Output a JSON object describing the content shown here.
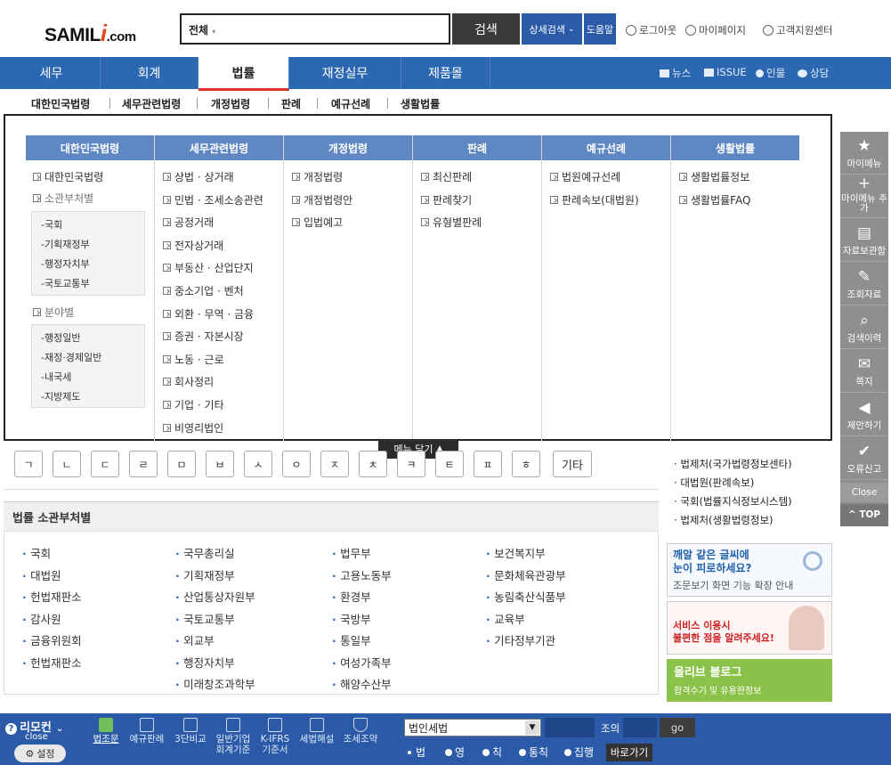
{
  "header": {
    "logo": {
      "left": "SAMIL",
      "i": "i",
      "right": ".com"
    },
    "search_scope": "전체",
    "search_button": "검색",
    "advanced_search": "상세검색",
    "help": "도움말",
    "logout": "로그아웃",
    "mypage": "마이페이지",
    "support": "고객지원센터"
  },
  "nav": {
    "items": [
      "세무",
      "회계",
      "법률",
      "재정실무",
      "제품몰"
    ],
    "active": "법률",
    "utils": [
      "뉴스",
      "ISSUE",
      "인물",
      "상담"
    ]
  },
  "subnav": [
    "대한민국법령",
    "세무관련법령",
    "개정법령",
    "판례",
    "예규선례",
    "생활법률"
  ],
  "panel": {
    "columns": [
      {
        "head": "대한민국법령",
        "links": [
          "대한민국법령"
        ],
        "group1": "소관부처별",
        "group1_items": [
          "국회",
          "기획재정부",
          "행정자치부",
          "국토교통부"
        ],
        "group2": "분야별",
        "group2_items": [
          "행정일반",
          "재정·경제일반",
          "내국세",
          "지방제도"
        ]
      },
      {
        "head": "세무관련법령",
        "links": [
          "상법 · 상거래",
          "민법 · 조세소송관련",
          "공정거래",
          "전자상거래",
          "부동산 · 산업단지",
          "중소기업 · 벤처",
          "외환 · 무역 · 금융",
          "증권 · 자본시장",
          "노동 · 근로",
          "회사정리",
          "기업 · 기타",
          "비영리법인"
        ]
      },
      {
        "head": "개정법령",
        "links": [
          "개정법령",
          "개정법령안",
          "입법예고"
        ]
      },
      {
        "head": "판례",
        "links": [
          "최신판례",
          "판례찾기",
          "유형별판례"
        ]
      },
      {
        "head": "예규선례",
        "links": [
          "법원예규선례",
          "판례속보(대법원)"
        ]
      },
      {
        "head": "생활법률",
        "links": [
          "생활법률정보",
          "생활법률FAQ"
        ]
      }
    ],
    "close_label": "메뉴 닫기"
  },
  "consonants": [
    "ㄱ",
    "ㄴ",
    "ㄷ",
    "ㄹ",
    "ㅁ",
    "ㅂ",
    "ㅅ",
    "ㅇ",
    "ㅈ",
    "ㅊ",
    "ㅋ",
    "ㅌ",
    "ㅍ",
    "ㅎ",
    "기타"
  ],
  "related_links": [
    "법제처(국가법령정보센타)",
    "대법원(판례속보)",
    "국회(법률지식정보시스템)",
    "법제처(생활법령정보)"
  ],
  "ministries": {
    "title": "법률 소관부처별",
    "col1": [
      "국회",
      "대법원",
      "헌법재판소",
      "감사원",
      "금융위원회",
      "헌법재판소"
    ],
    "col2": [
      "국무총리실",
      "기획재정부",
      "산업통상자원부",
      "국토교통부",
      "외교부",
      "행정자치부",
      "미래창조과학부"
    ],
    "col3": [
      "법무부",
      "고용노동부",
      "환경부",
      "국방부",
      "통일부",
      "여성가족부",
      "해양수산부"
    ],
    "col4": [
      "보건복지부",
      "문화체육관광부",
      "농림축산식품부",
      "교육부",
      "기타정부기관"
    ]
  },
  "ads": {
    "ad1_title1": "깨알 같은 글씨에",
    "ad1_title2": "눈이 피로하세요?",
    "ad1_sub": "조문보기 화면 기능 확장 안내",
    "ad2_line1": "서비스 이용시",
    "ad2_line2": "불편한 점을 알려주세요!",
    "ad3_title": "올리브 블로그",
    "ad3_sub": "합격수기 및 유용한정보"
  },
  "dock": {
    "items": [
      "마이메뉴",
      "마이메뉴 추가",
      "자료보관함",
      "조회자료",
      "검색이력",
      "쪽지",
      "제안하기",
      "오류신고"
    ],
    "icons": [
      "star-icon",
      "plus-icon",
      "document-icon",
      "edit-icon",
      "search-icon",
      "message-icon",
      "megaphone-icon",
      "check-icon"
    ],
    "close": "Close",
    "top": "TOP"
  },
  "bottom": {
    "remote": "리모컨",
    "remote_close": "close",
    "settings": "설정",
    "tools": [
      "법조문",
      "예규판례",
      "3단비교",
      "일반기업 회계기준",
      "K-IFRS 기준서",
      "세법해설",
      "조세조약"
    ],
    "law_select": "법인세법",
    "jo": "조의",
    "go": "go",
    "radios": [
      "법",
      "영",
      "칙",
      "통칙",
      "집행"
    ],
    "shortcut": "바로가기"
  }
}
